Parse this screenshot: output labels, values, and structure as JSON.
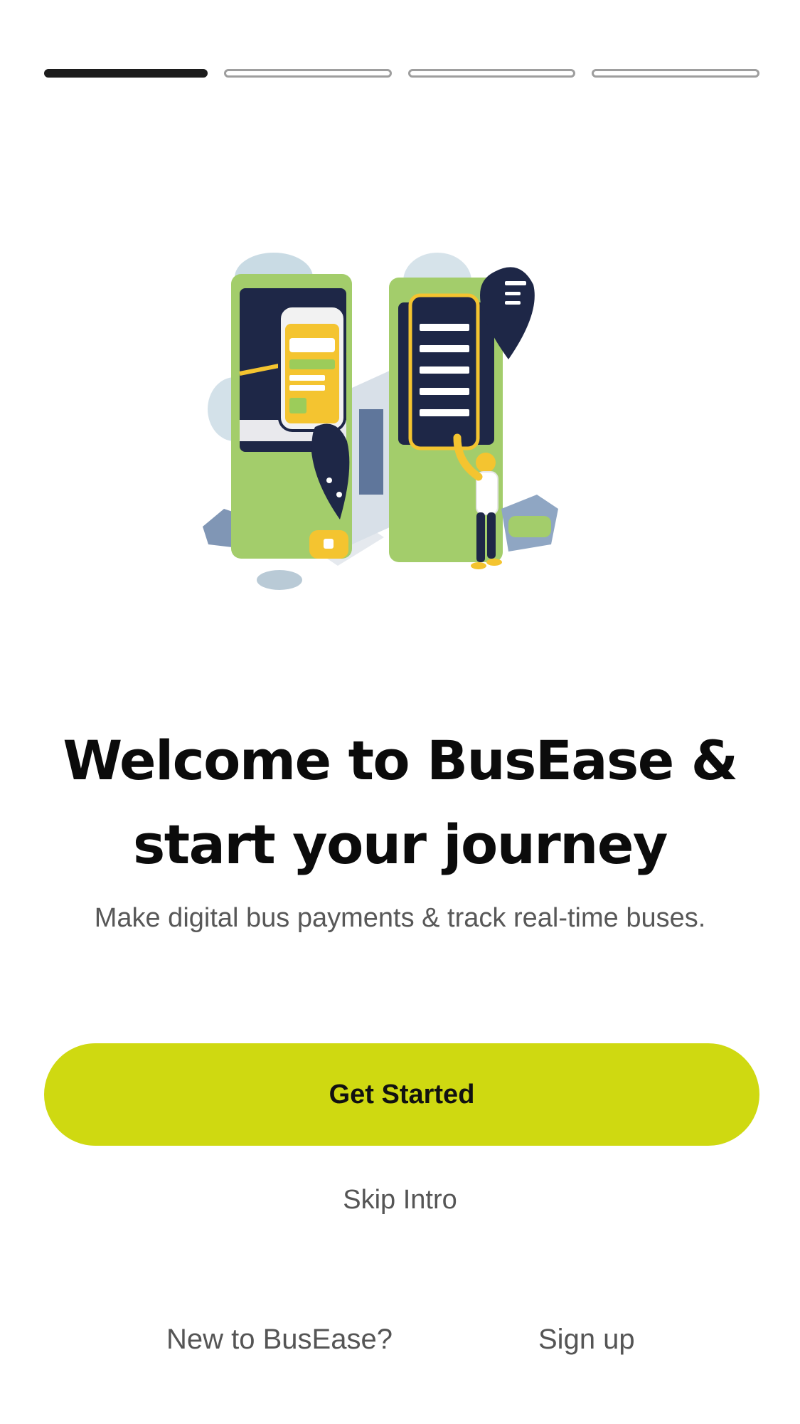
{
  "onboarding": {
    "progress": {
      "total_steps": 4,
      "current_step": 1
    },
    "headline_line1": "Welcome to BusEase &",
    "headline_line2": "start your journey",
    "subtitle": "Make digital bus payments & track real-time buses."
  },
  "actions": {
    "primary_label": "Get Started",
    "skip_label": "Skip Intro"
  },
  "footer": {
    "prompt": "New to BusEase?",
    "signup_label": "Sign up"
  },
  "colors": {
    "accent": "#cfd911",
    "active_step": "#1c1c1c",
    "inactive_step_border": "#9e9e9e",
    "illustration_green": "#a3cd6b",
    "illustration_navy": "#1e2747",
    "illustration_yellow": "#f4c430"
  },
  "icons": {
    "illustration": "bus-app-phones-illustration"
  }
}
